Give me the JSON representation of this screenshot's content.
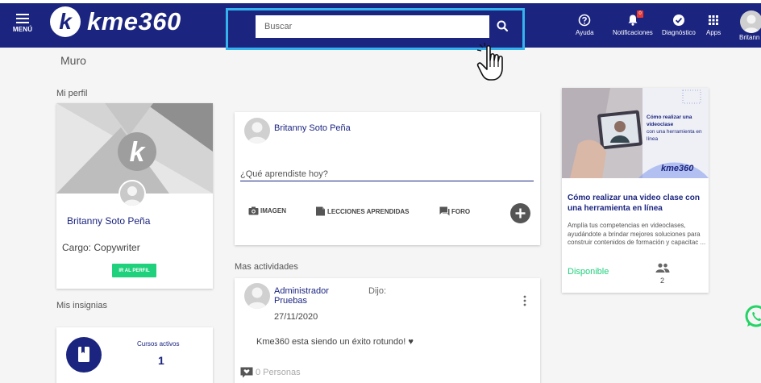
{
  "header": {
    "menu_label": "MENÚ",
    "logo_letter": "k",
    "logo_text": "kme360",
    "search_placeholder": "Buscar",
    "items": [
      {
        "label": "Ayuda",
        "icon": "help-icon"
      },
      {
        "label": "Notificaciones",
        "icon": "bell-icon",
        "badge": "0"
      },
      {
        "label": "Diagnóstico",
        "icon": "check-circle-icon"
      },
      {
        "label": "Apps",
        "icon": "apps-grid-icon"
      }
    ],
    "user_label": "Britann"
  },
  "page": {
    "title": "Muro",
    "my_profile_label": "Mi perfil",
    "my_badges_label": "Mis insignias",
    "more_activities_label": "Mas actividades"
  },
  "profile": {
    "name": "Britanny Soto Peña",
    "role": "Cargo: Copywriter",
    "button_label": "IR AL PERFIL"
  },
  "badges": {
    "courses_label": "Cursos activos",
    "courses_value": "1"
  },
  "composer": {
    "user_name": "Britanny Soto Peña",
    "placeholder": "¿Qué aprendiste hoy?",
    "actions": {
      "image": "IMAGEN",
      "lessons": "LECCIONES APRENDIDAS",
      "forum": "FORO"
    }
  },
  "activity": {
    "author": "Administrador Pruebas",
    "said": "Dijo:",
    "date": "27/11/2020",
    "text": "Kme360 esta siendo un éxito rotundo! ♥",
    "likes": "0 Personas"
  },
  "promo": {
    "overlay_title": "Cómo realizar una videoclase",
    "overlay_subtitle": "con una herramienta en línea",
    "overlay_logo": "kme360",
    "title": "Cómo realizar una video clase con una herramienta en línea",
    "description": "Amplía tus competencias en videoclases, ayudándote a brindar mejores soluciones para construir contenidos de formación y capacitac ...",
    "status": "Disponible",
    "people_count": "2"
  },
  "colors": {
    "header_bg": "#1b2580",
    "search_highlight": "#35b3ee",
    "accent_green": "#1fd07c",
    "whatsapp": "#25d366"
  }
}
